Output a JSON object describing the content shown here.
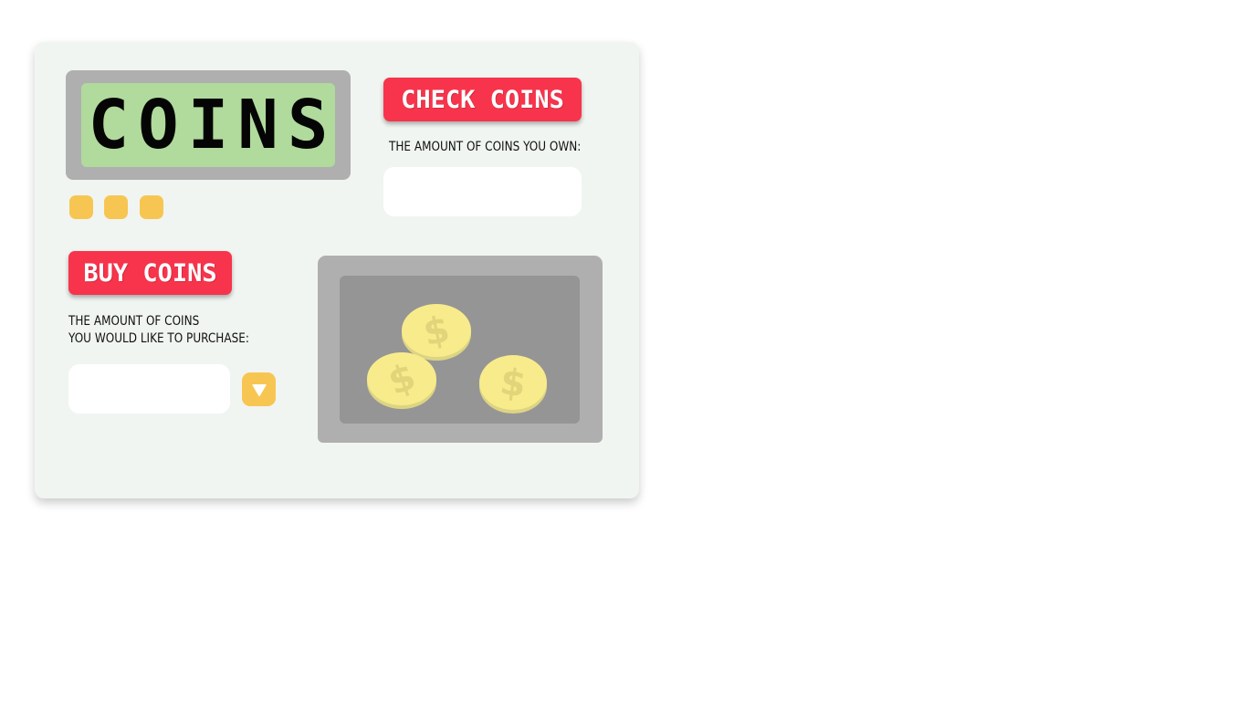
{
  "display": {
    "text": "COINS"
  },
  "check": {
    "button_label": "CHECK COINS",
    "caption": "THE AMOUNT OF COINS YOU OWN:",
    "value": ""
  },
  "buy": {
    "button_label": "BUY COINS",
    "caption_line1": "THE AMOUNT OF COINS",
    "caption_line2": "YOU WOULD LIKE TO PURCHASE:",
    "value": ""
  },
  "coins": [
    {
      "symbol": "$"
    },
    {
      "symbol": "$"
    },
    {
      "symbol": "$"
    }
  ],
  "colors": {
    "accent_red": "#f7344c",
    "indicator_yellow": "#f7c652",
    "screen_green": "#b1da9d",
    "coin_yellow": "#f8eb8c"
  },
  "icons": {
    "submit": "chevron-down-icon",
    "coin": "dollar-coin-icon"
  }
}
